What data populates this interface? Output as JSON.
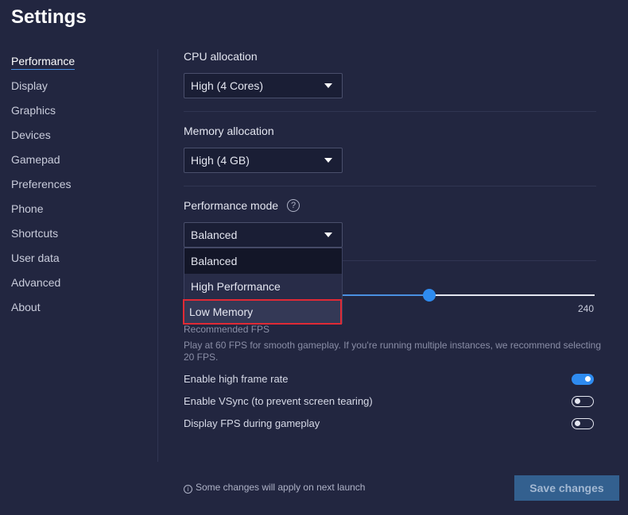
{
  "page": {
    "title": "Settings"
  },
  "sidebar": {
    "items": [
      {
        "label": "Performance"
      },
      {
        "label": "Display"
      },
      {
        "label": "Graphics"
      },
      {
        "label": "Devices"
      },
      {
        "label": "Gamepad"
      },
      {
        "label": "Preferences"
      },
      {
        "label": "Phone"
      },
      {
        "label": "Shortcuts"
      },
      {
        "label": "User data"
      },
      {
        "label": "Advanced"
      },
      {
        "label": "About"
      }
    ],
    "active_index": 0
  },
  "performance": {
    "cpu": {
      "label": "CPU allocation",
      "value": "High (4 Cores)"
    },
    "memory": {
      "label": "Memory allocation",
      "value": "High (4 GB)"
    },
    "mode": {
      "label": "Performance mode",
      "help_icon": "?",
      "value": "Balanced",
      "options": [
        "Balanced",
        "High Performance",
        "Low Memory"
      ],
      "selected_option": "Balanced",
      "highlighted_option": "Low Memory"
    },
    "fps": {
      "max_label": "240",
      "hint": "Recommended FPS",
      "description": "Play at 60 FPS for smooth gameplay. If you're running multiple instances, we recommend selecting 20 FPS."
    },
    "toggles": [
      {
        "label": "Enable high frame rate",
        "on": true
      },
      {
        "label": "Enable VSync (to prevent screen tearing)",
        "on": false
      },
      {
        "label": "Display FPS during gameplay",
        "on": false
      }
    ]
  },
  "footer": {
    "info_icon": "i",
    "note": "Some changes will apply on next launch",
    "save_label": "Save changes"
  },
  "colors": {
    "background": "#222640",
    "accent": "#2e8bf0",
    "highlight_border": "#e02a35",
    "save_button": "#33608f"
  }
}
